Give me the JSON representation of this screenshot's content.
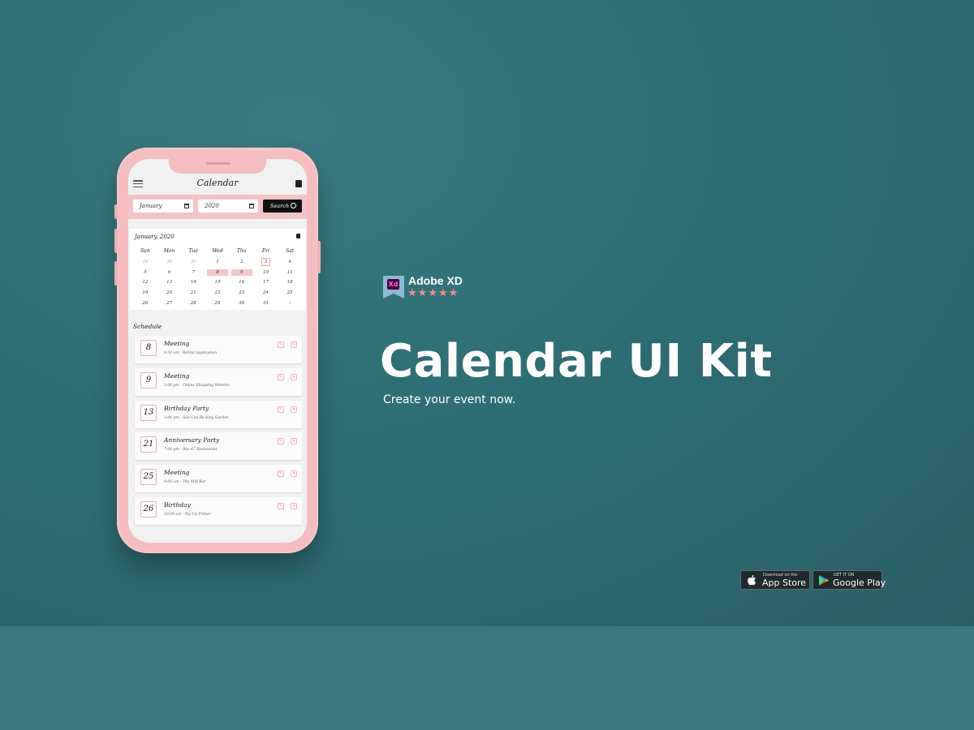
{
  "app": {
    "title": "Calendar",
    "search": {
      "month_value": "January",
      "year_value": "2020",
      "button_label": "Search"
    },
    "calendar": {
      "month_label": "January, 2020",
      "weekdays": [
        "Sun",
        "Mon",
        "Tue",
        "Wed",
        "Thu",
        "Fri",
        "Sat"
      ],
      "weeks": [
        [
          {
            "d": "29",
            "m": true
          },
          {
            "d": "30",
            "m": true
          },
          {
            "d": "31",
            "m": true
          },
          {
            "d": "1"
          },
          {
            "d": "2"
          },
          {
            "d": "3",
            "today": true
          },
          {
            "d": "4"
          }
        ],
        [
          {
            "d": "5"
          },
          {
            "d": "6"
          },
          {
            "d": "7"
          },
          {
            "d": "8",
            "sel": true
          },
          {
            "d": "9",
            "sel": true
          },
          {
            "d": "10"
          },
          {
            "d": "11"
          }
        ],
        [
          {
            "d": "12"
          },
          {
            "d": "13"
          },
          {
            "d": "14"
          },
          {
            "d": "15"
          },
          {
            "d": "16"
          },
          {
            "d": "17"
          },
          {
            "d": "18"
          }
        ],
        [
          {
            "d": "19"
          },
          {
            "d": "20"
          },
          {
            "d": "21"
          },
          {
            "d": "22"
          },
          {
            "d": "23"
          },
          {
            "d": "24"
          },
          {
            "d": "25"
          }
        ],
        [
          {
            "d": "26"
          },
          {
            "d": "27"
          },
          {
            "d": "28"
          },
          {
            "d": "29"
          },
          {
            "d": "30"
          },
          {
            "d": "31"
          },
          {
            "d": "1",
            "m": true
          }
        ]
      ]
    },
    "schedule_label": "Schedule",
    "events": [
      {
        "day": "8",
        "title": "Meeting",
        "detail": "8:30 am - Rental Application"
      },
      {
        "day": "9",
        "title": "Meeting",
        "detail": "3:00 pm - Online Shopping Website"
      },
      {
        "day": "13",
        "title": "Birthday Party",
        "detail": "3:00 pm - Sun Can Be Kiny Garden"
      },
      {
        "day": "21",
        "title": "Anniversary Party",
        "detail": "7:00 pm - Bus 47 Restaurant"
      },
      {
        "day": "25",
        "title": "Meeting",
        "detail": "9:00 am - The Mill Bar"
      },
      {
        "day": "26",
        "title": "Birthday",
        "detail": "10:00 am - My Up Primer"
      }
    ]
  },
  "promo": {
    "tool_name": "Adobe XD",
    "tool_logo_text": "Xd",
    "rating": "★★★★★",
    "headline": "Calendar UI Kit",
    "tagline": "Create your event now."
  },
  "stores": {
    "apple": {
      "small": "Download on the",
      "big": "App Store"
    },
    "google": {
      "small": "GET IT ON",
      "big": "Google Play"
    }
  },
  "colors": {
    "background": "#2f6d75",
    "band": "#3d7783",
    "phone": "#f4bdbf",
    "accent": "#f28c8c"
  }
}
